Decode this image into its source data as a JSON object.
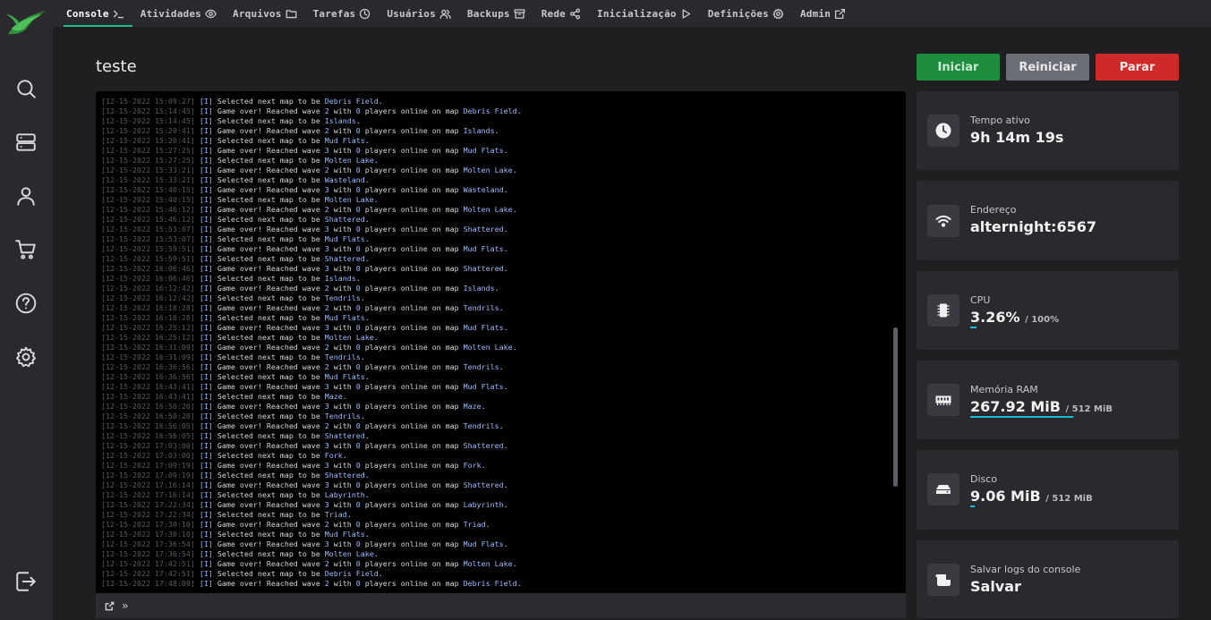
{
  "nav": [
    {
      "label": "Console",
      "icon": "terminal-icon",
      "active": true
    },
    {
      "label": "Atividades",
      "icon": "eye-icon"
    },
    {
      "label": "Arquivos",
      "icon": "folder-icon"
    },
    {
      "label": "Tarefas",
      "icon": "clock-icon"
    },
    {
      "label": "Usuários",
      "icon": "users-icon"
    },
    {
      "label": "Backups",
      "icon": "archive-icon"
    },
    {
      "label": "Rede",
      "icon": "share-icon"
    },
    {
      "label": "Inicialização",
      "icon": "play-icon"
    },
    {
      "label": "Definições",
      "icon": "gear-icon"
    },
    {
      "label": "Admin",
      "icon": "external-link-icon"
    }
  ],
  "rail": [
    "search-icon",
    "servers-icon",
    "account-icon",
    "cart-icon",
    "help-icon",
    "settings-icon",
    "logout-icon"
  ],
  "server": {
    "name": "teste"
  },
  "power": {
    "start": "Iniciar",
    "restart": "Reiniciar",
    "stop": "Parar"
  },
  "console": {
    "info_tag": "[I]",
    "lines": [
      [
        "12-15-2022 15:09:27",
        "select",
        "Debris Field"
      ],
      [
        "12-15-2022 15:14:45",
        "over",
        "2",
        "Debris Field"
      ],
      [
        "12-15-2022 15:14:45",
        "select",
        "Islands"
      ],
      [
        "12-15-2022 15:20:41",
        "over",
        "2",
        "Islands"
      ],
      [
        "12-15-2022 15:20:41",
        "select",
        "Mud Flats"
      ],
      [
        "12-15-2022 15:27:25",
        "over",
        "3",
        "Mud Flats"
      ],
      [
        "12-15-2022 15:27:25",
        "select",
        "Molten Lake"
      ],
      [
        "12-15-2022 15:33:21",
        "over",
        "2",
        "Molten Lake"
      ],
      [
        "12-15-2022 15:33:21",
        "select",
        "Wasteland"
      ],
      [
        "12-15-2022 15:40:15",
        "over",
        "3",
        "Wasteland"
      ],
      [
        "12-15-2022 15:40:15",
        "select",
        "Molten Lake"
      ],
      [
        "12-15-2022 15:46:12",
        "over",
        "2",
        "Molten Lake"
      ],
      [
        "12-15-2022 15:46:12",
        "select",
        "Shattered"
      ],
      [
        "12-15-2022 15:53:07",
        "over",
        "3",
        "Shattered"
      ],
      [
        "12-15-2022 15:53:07",
        "select",
        "Mud Flats"
      ],
      [
        "12-15-2022 15:59:51",
        "over",
        "3",
        "Mud Flats"
      ],
      [
        "12-15-2022 15:59:51",
        "select",
        "Shattered"
      ],
      [
        "12-15-2022 16:06:46",
        "over",
        "3",
        "Shattered"
      ],
      [
        "12-15-2022 16:06:46",
        "select",
        "Islands"
      ],
      [
        "12-15-2022 16:12:42",
        "over",
        "2",
        "Islands"
      ],
      [
        "12-15-2022 16:12:42",
        "select",
        "Tendrils"
      ],
      [
        "12-15-2022 16:18:28",
        "over",
        "2",
        "Tendrils"
      ],
      [
        "12-15-2022 16:18:28",
        "select",
        "Mud Flats"
      ],
      [
        "12-15-2022 16:25:12",
        "over",
        "3",
        "Mud Flats"
      ],
      [
        "12-15-2022 16:25:12",
        "select",
        "Molten Lake"
      ],
      [
        "12-15-2022 16:31:09",
        "over",
        "2",
        "Molten Lake"
      ],
      [
        "12-15-2022 16:31:09",
        "select",
        "Tendrils"
      ],
      [
        "12-15-2022 16:36:56",
        "over",
        "2",
        "Tendrils"
      ],
      [
        "12-15-2022 16:36:56",
        "select",
        "Mud Flats"
      ],
      [
        "12-15-2022 16:43:41",
        "over",
        "3",
        "Mud Flats"
      ],
      [
        "12-15-2022 16:43:41",
        "select",
        "Maze"
      ],
      [
        "12-15-2022 16:50:20",
        "over",
        "3",
        "Maze"
      ],
      [
        "12-15-2022 16:50:20",
        "select",
        "Tendrils"
      ],
      [
        "12-15-2022 16:56:05",
        "over",
        "2",
        "Tendrils"
      ],
      [
        "12-15-2022 16:56:05",
        "select",
        "Shattered"
      ],
      [
        "12-15-2022 17:03:00",
        "over",
        "3",
        "Shattered"
      ],
      [
        "12-15-2022 17:03:00",
        "select",
        "Fork"
      ],
      [
        "12-15-2022 17:09:19",
        "over",
        "3",
        "Fork"
      ],
      [
        "12-15-2022 17:09:19",
        "select",
        "Shattered"
      ],
      [
        "12-15-2022 17:16:14",
        "over",
        "3",
        "Shattered"
      ],
      [
        "12-15-2022 17:16:14",
        "select",
        "Labyrinth"
      ],
      [
        "12-15-2022 17:22:34",
        "over",
        "3",
        "Labyrinth"
      ],
      [
        "12-15-2022 17:22:34",
        "select",
        "Triad"
      ],
      [
        "12-15-2022 17:30:10",
        "over",
        "2",
        "Triad"
      ],
      [
        "12-15-2022 17:30:10",
        "select",
        "Mud Flats"
      ],
      [
        "12-15-2022 17:36:54",
        "over",
        "3",
        "Mud Flats"
      ],
      [
        "12-15-2022 17:36:54",
        "select",
        "Molten Lake"
      ],
      [
        "12-15-2022 17:42:51",
        "over",
        "2",
        "Molten Lake"
      ],
      [
        "12-15-2022 17:42:51",
        "select",
        "Debris Field"
      ],
      [
        "12-15-2022 17:48:09",
        "over",
        "2",
        "Debris Field"
      ]
    ],
    "input_value": "",
    "input_prompt": "»"
  },
  "stats": {
    "uptime": {
      "label": "Tempo ativo",
      "value": "9h 14m 19s"
    },
    "address": {
      "label": "Endereço",
      "value": "alternight:6567"
    },
    "cpu": {
      "label": "CPU",
      "value": "3.26%",
      "limit": "/ 100%",
      "fraction": 0.0326
    },
    "memory": {
      "label": "Memória RAM",
      "value": "267.92 MiB",
      "limit": "/ 512 MiB",
      "fraction": 0.5233
    },
    "disk": {
      "label": "Disco",
      "value": "9.06 MiB",
      "limit": "/ 512 MiB",
      "fraction": 0.0177
    },
    "logs": {
      "label": "Salvar logs do console",
      "value": "Salvar"
    }
  },
  "colors": {
    "accent": "#1dbd8f",
    "start": "#1e8e3e",
    "restart": "#6b6d77",
    "stop": "#cf2a2a",
    "bar": "#22b8d8"
  }
}
